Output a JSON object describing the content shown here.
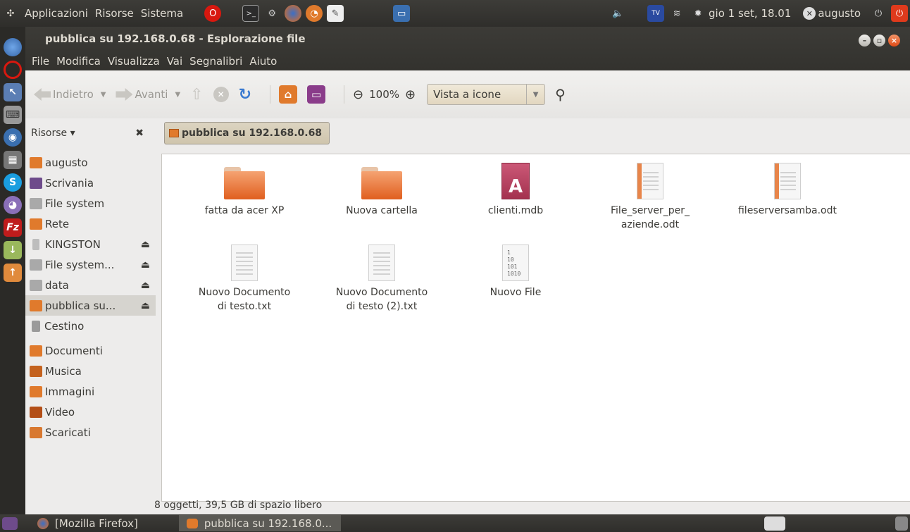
{
  "top_panel": {
    "menus": [
      "Applicazioni",
      "Risorse",
      "Sistema"
    ],
    "clock": "gio  1 set, 18.01",
    "user": "augusto"
  },
  "window": {
    "title": "pubblica su 192.168.0.68 - Esplorazione file",
    "menubar": [
      "File",
      "Modifica",
      "Visualizza",
      "Vai",
      "Segnalibri",
      "Aiuto"
    ]
  },
  "toolbar": {
    "back_label": "Indietro",
    "forward_label": "Avanti",
    "zoom": "100%",
    "view_mode": "Vista a icone"
  },
  "sidebar": {
    "header": "Risorse ▾",
    "items": [
      {
        "label": "augusto",
        "color": "#e07a2c",
        "eject": false
      },
      {
        "label": "Scrivania",
        "color": "#6e4b8b",
        "eject": false
      },
      {
        "label": "File system",
        "color": "#a9a9a9",
        "eject": false
      },
      {
        "label": "Rete",
        "color": "#e07a2c",
        "eject": false
      },
      {
        "label": "KINGSTON",
        "color": "#bdbdbd",
        "eject": true
      },
      {
        "label": "File system...",
        "color": "#a9a9a9",
        "eject": true
      },
      {
        "label": "data",
        "color": "#a9a9a9",
        "eject": true
      },
      {
        "label": "pubblica su...",
        "color": "#e07a2c",
        "eject": true
      },
      {
        "label": "Cestino",
        "color": "#9a9a9a",
        "eject": false
      }
    ],
    "bookmarks": [
      {
        "label": "Documenti",
        "color": "#e07a2c"
      },
      {
        "label": "Musica",
        "color": "#c4621e"
      },
      {
        "label": "Immagini",
        "color": "#e07a2c"
      },
      {
        "label": "Video",
        "color": "#b34e16"
      },
      {
        "label": "Scaricati",
        "color": "#d87830"
      }
    ]
  },
  "breadcrumb": "pubblica su 192.168.0.68",
  "files": [
    {
      "name": "fatta da acer XP",
      "type": "folder"
    },
    {
      "name": "Nuova cartella",
      "type": "folder"
    },
    {
      "name": "clienti.mdb",
      "type": "access"
    },
    {
      "name": "File_server_per_\naziende.odt",
      "type": "odt"
    },
    {
      "name": "fileserversamba.odt",
      "type": "odt"
    },
    {
      "name": "Nuovo Documento\ndi testo.txt",
      "type": "txt"
    },
    {
      "name": "Nuovo Documento\ndi testo (2).txt",
      "type": "txt"
    },
    {
      "name": "Nuovo File",
      "type": "binary"
    }
  ],
  "status": "8 oggetti, 39,5 GB di spazio libero",
  "taskbar": [
    {
      "label": "[Mozilla Firefox]",
      "active": false
    },
    {
      "label": "pubblica su 192.168.0...",
      "active": true
    }
  ]
}
